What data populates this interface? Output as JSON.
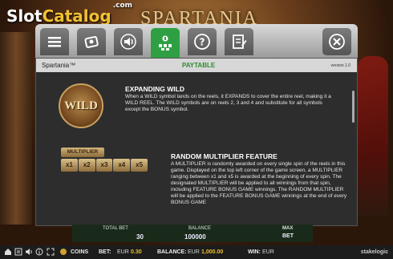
{
  "watermark": {
    "logo_part1": "Slot",
    "logo_part2": "Catalog",
    "logo_suffix": ".com"
  },
  "background": {
    "game_title": "SPARTANIA"
  },
  "tabs": [
    {
      "name": "menu-icon",
      "active": false
    },
    {
      "name": "settings-icon",
      "active": false
    },
    {
      "name": "sound-icon",
      "active": false
    },
    {
      "name": "paytable-icon",
      "active": true
    },
    {
      "name": "help-icon",
      "active": false
    },
    {
      "name": "history-icon",
      "active": false
    }
  ],
  "panel": {
    "game_name": "Spartania™",
    "section_title": "PAYTABLE",
    "version": "version 1.0"
  },
  "expanding_wild": {
    "title": "EXPANDING WILD",
    "symbol_text": "WILD",
    "text": "When a WILD symbol lands on the reels, it EXPANDS to cover the entire reel, making it a WILD REEL. The WILD symbols are on reels 2, 3 and 4 and substitute for all symbols except the BONUS symbol."
  },
  "multiplier": {
    "title": "RANDOM MULTIPLIER FEATURE",
    "label": "MULTIPLIER",
    "tiles": [
      "x1",
      "x2",
      "x3",
      "x4",
      "x5"
    ],
    "text": "A MULTIPLIER is randomly awarded on every single spin of the reels in this game. Displayed on the top left corner of the game screen, a MULTIPLIER ranging between x1 and x5 is awarded at the beginning of every spin. The designated MULTIPLIER will be applied to all winnings from that spin, including FEATURE BONUS GAME winnings. The RANDOM MULTIPLIER will be applied to the FEATURE BONUS GAME winnings at the end of every BONUS GAME"
  },
  "under_panel": {
    "total_bet_label": "TOTAL BET",
    "total_bet_value": "30",
    "balance_label": "BALANCE",
    "balance_value": "100000",
    "max_bet_label": "MAX",
    "max_bet_label2": "BET"
  },
  "statusbar": {
    "coins": "COINS",
    "bet_label": "BET:",
    "bet_currency": "EUR",
    "bet_value": "0.30",
    "balance_label": "BALANCE:",
    "balance_currency": "EUR",
    "balance_value": "1,000.00",
    "win_label": "WIN:",
    "win_currency": "EUR",
    "brand": "stakelogic"
  },
  "colors": {
    "active_tab": "#2ea043",
    "paytable_title": "#2e8b2e",
    "amount": "#f0c030"
  }
}
